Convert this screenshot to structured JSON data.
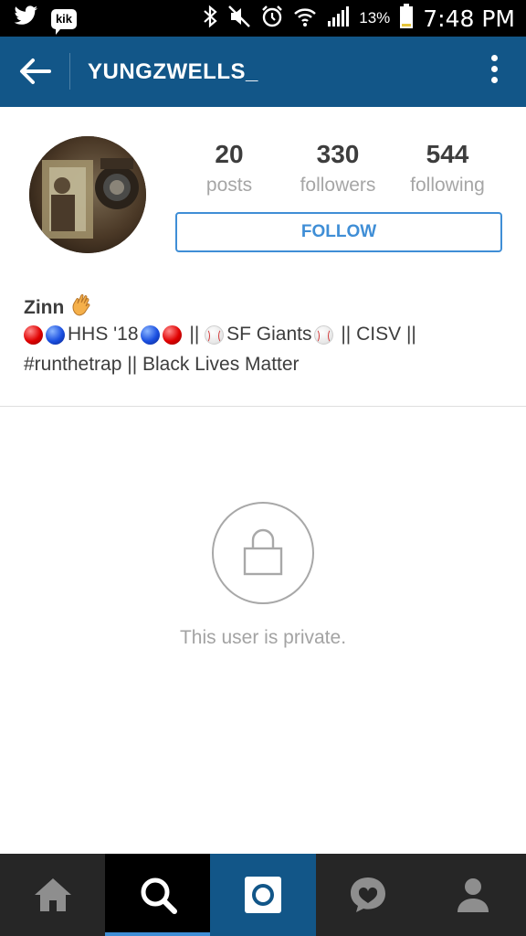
{
  "status_bar": {
    "left_icons": [
      "twitter-icon",
      "kik-icon"
    ],
    "kik_label": "kik",
    "right_icons": [
      "bluetooth-icon",
      "mute-icon",
      "alarm-icon",
      "wifi-icon",
      "signal-icon",
      "battery-icon"
    ],
    "battery_percent": "13%",
    "time": "7:48 PM"
  },
  "header": {
    "username": "YUNGZWELLS_",
    "back_icon": "arrow-left-icon",
    "menu_icon": "more-vert-icon",
    "background": "#125688"
  },
  "profile": {
    "stats": [
      {
        "value": "20",
        "label": "posts"
      },
      {
        "value": "330",
        "label": "followers"
      },
      {
        "value": "544",
        "label": "following"
      }
    ],
    "follow_label": "FOLLOW",
    "name": "Zinn",
    "bio_line1": {
      "hhs": "HHS '18",
      "separator1": " || ",
      "giants": "SF Giants",
      "separator2": " || ",
      "cisv": "CISV ||"
    },
    "bio_line2": "#runthetrap || Black Lives Matter"
  },
  "private": {
    "message": "This user is private.",
    "icon": "lock-icon"
  },
  "bottom_nav": {
    "items": [
      "home-icon",
      "search-icon",
      "camera-icon",
      "activity-icon",
      "profile-icon"
    ],
    "active": "search-icon"
  },
  "colors": {
    "accent": "#3f8ed6",
    "header": "#125688",
    "nav": "#262626"
  }
}
